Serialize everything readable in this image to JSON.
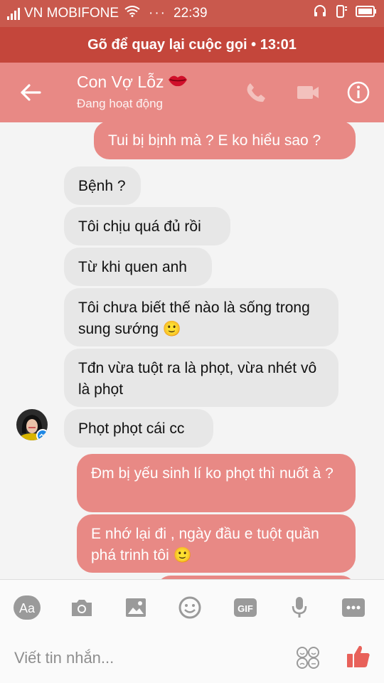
{
  "status_bar": {
    "carrier": "VN MOBIFONE",
    "dots": "···",
    "time": "22:39"
  },
  "call_banner": {
    "text": "Gõ để quay lại cuộc gọi • 13:01"
  },
  "header": {
    "title": "Con Vợ Lỗz",
    "status": "Đang hoạt động",
    "accent_color": "#e88985"
  },
  "messages": [
    {
      "side": "out",
      "text": "Tui bị bịnh mà ? E ko hiểu sao ?"
    },
    {
      "side": "in",
      "text": "Bệnh ?"
    },
    {
      "side": "in",
      "text": "Tôi chịu quá đủ rồi"
    },
    {
      "side": "in",
      "text": "Từ khi quen anh"
    },
    {
      "side": "in",
      "text": "Tôi chưa biết thế nào là sống trong sung sướng 🙂"
    },
    {
      "side": "in",
      "text": "Tđn vừa tuột ra là phọt,  vừa nhét vô là phọt"
    },
    {
      "side": "in",
      "text": "Phọt phọt cái cc"
    },
    {
      "side": "out",
      "text": "Đm bị yếu sinh lí ko phọt thì nuốt à ?"
    },
    {
      "side": "out",
      "text": "E nhớ lại đi , ngày đầu e tuột quần phá trinh tôi 🙂"
    }
  ],
  "toolbar": {
    "aa_label": "Aa",
    "gif_label": "GIF",
    "icons": [
      "aa-icon",
      "camera-icon",
      "gallery-icon",
      "emoji-icon",
      "gif-icon",
      "microphone-icon",
      "more-icon"
    ]
  },
  "composer": {
    "placeholder": "Viết tin nhắn..."
  }
}
